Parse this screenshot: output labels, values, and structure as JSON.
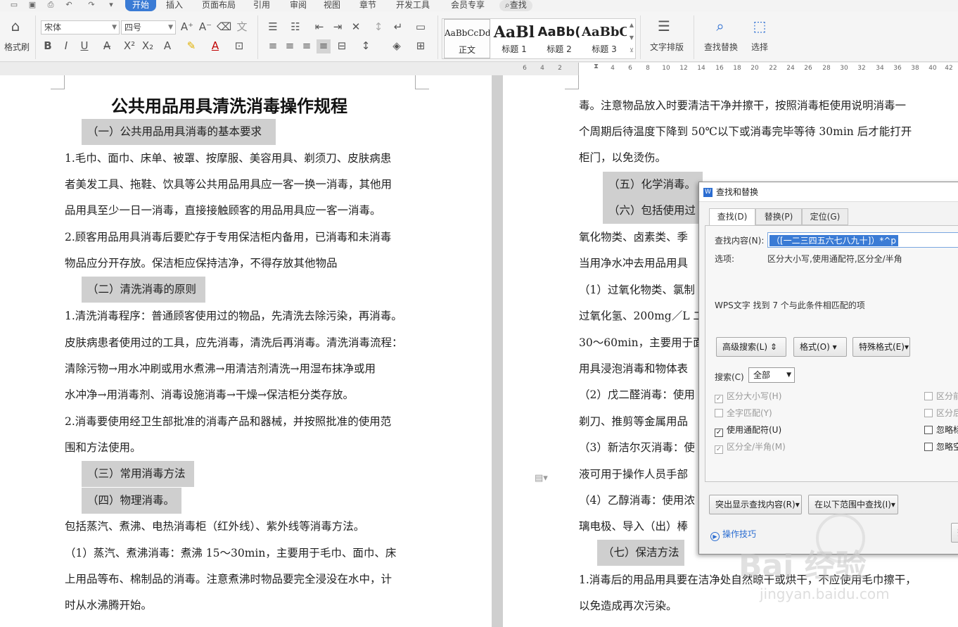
{
  "menubar": {
    "quick_icons": [
      "folder-icon",
      "save-icon",
      "print-icon",
      "preview-icon",
      "undo-icon",
      "redo-icon",
      "more-icon"
    ],
    "items": [
      "开始",
      "插入",
      "页面布局",
      "引用",
      "审阅",
      "视图",
      "章节",
      "开发工具",
      "会员专享"
    ],
    "search_label": "查找"
  },
  "ribbon": {
    "format_painter": "格式刷",
    "font_name": "宋体",
    "font_size": "四号",
    "styles": [
      {
        "preview": "AaBbCcDd",
        "name": "正文"
      },
      {
        "preview": "AaBl",
        "name": "标题 1"
      },
      {
        "preview": "AaBb(",
        "name": "标题 2"
      },
      {
        "preview": "AaBbC",
        "name": "标题 3"
      }
    ],
    "text_layout": "文字排版",
    "find_replace": "查找替换",
    "select": "选择"
  },
  "ruler": {
    "left_ticks": [
      "6",
      "4",
      "2"
    ],
    "right_ticks": [
      "2",
      "4",
      "6",
      "8",
      "10",
      "12",
      "14",
      "16",
      "18",
      "20",
      "22",
      "24",
      "26",
      "28",
      "30",
      "32",
      "34",
      "36",
      "38",
      "40",
      "42"
    ]
  },
  "doc_left": {
    "title": "公共用品用具清洗消毒操作规程",
    "h1": "（一）公共用品用具消毒的基本要求",
    "p1": [
      "1.毛巾、面巾、床单、被罩、按摩服、美容用具、剃须刀、皮肤病患",
      "者美发工具、拖鞋、饮具等公共用品用具应一客一换一消毒，其他用",
      "品用具至少一日一消毒，直接接触顾客的用品用具应一客一消毒。"
    ],
    "p2": [
      "2.顾客用品用具消毒后要贮存于专用保洁柜内备用，已消毒和未消毒",
      "物品应分开存放。保洁柜应保持洁净，不得存放其他物品"
    ],
    "h2": "（二）清洗消毒的原则",
    "p3": [
      "1.清洗消毒程序：普通顾客使用过的物品，先清洗去除污染，再消毒。",
      "皮肤病患者使用过的工具，应先消毒，清洗后再消毒。清洗消毒流程：",
      "清除污物→用水冲刷或用水煮沸→用清洁剂清洗→用湿布抹净或用",
      "水冲净→用消毒剂、消毒设施消毒→干燥→保洁柜分类存放。"
    ],
    "p4": [
      "2.消毒要使用经卫生部批准的消毒产品和器械，并按照批准的使用范",
      "围和方法使用。"
    ],
    "h3": "（三）常用消毒方法",
    "h4": "（四）物理消毒。",
    "p5": [
      "包括蒸汽、煮沸、电热消毒柜（红外线）、紫外线等消毒方法。"
    ],
    "p6": [
      "（1）蒸汽、煮沸消毒：煮沸 15～30min，主要用于毛巾、面巾、床",
      "上用品等布、棉制品的消毒。注意煮沸时物品要完全浸没在水中，计",
      "时从水沸腾开始。"
    ]
  },
  "doc_right": {
    "lines1": [
      "毒。注意物品放入时要清洁干净并擦干，按照消毒柜使用说明消毒一",
      "个周期后待温度下降到 50℃以下或消毒完毕等待 30min 后才能打开",
      "柜门，以免烫伤。"
    ],
    "h5": "（五）化学消毒。",
    "h6": "（六）包括使用过",
    "lines2": [
      "氧化物类、卤素类、季",
      "当用净水冲去用品用具",
      "（1）过氧化物类、氯制",
      "过氧化氢、200mg／L 二",
      "30～60min，主要用于面",
      "用具浸泡消毒和物体表",
      "（2）戊二醛消毒：使用",
      "剃刀、推剪等金属用品",
      "（3）新洁尔灭消毒：使",
      "液可用于操作人员手部",
      "（4）乙醇消毒：使用浓",
      "璃电极、导入（出）棒"
    ],
    "h7": "（七）保洁方法",
    "lines3": [
      "1.消毒后的用品用具要在洁净处自然晾干或烘干，不应使用毛巾擦干，",
      "以免造成再次污染。"
    ]
  },
  "dialog": {
    "title": "查找和替换",
    "tabs": [
      "查找(D)",
      "替换(P)",
      "定位(G)"
    ],
    "find_label": "查找内容(N):",
    "find_value": "（[一二三四五六七八九十]）*^p",
    "options_label": "选项:",
    "options_value": "区分大小写,使用通配符,区分全/半角",
    "result": "WPS文字 找到 7 个与此条件相匹配的项",
    "btn_advanced": "高级搜索(L) ⇕",
    "btn_format": "格式(O)",
    "btn_special": "特殊格式(E)",
    "search_label": "搜索(C)",
    "search_value": "全部",
    "checks": [
      {
        "label": "区分大小写(H)",
        "checked": true,
        "enabled": false
      },
      {
        "label": "全字匹配(Y)",
        "checked": false,
        "enabled": false
      },
      {
        "label": "使用通配符(U)",
        "checked": true,
        "enabled": true
      },
      {
        "label": "区分全/半角(M)",
        "checked": true,
        "enabled": false
      }
    ],
    "checks_right": [
      {
        "label": "区分前",
        "enabled": false
      },
      {
        "label": "区分后",
        "enabled": false
      },
      {
        "label": "忽略标",
        "enabled": true
      },
      {
        "label": "忽略空",
        "enabled": true
      }
    ],
    "btn_highlight": "突出显示查找内容(R)",
    "btn_find_in": "在以下范围中查找(I)",
    "tips": "操作技巧",
    "btn_partial": "查"
  },
  "watermark": {
    "text": "Bai 经验",
    "url": "jingyan.baidu.com"
  }
}
